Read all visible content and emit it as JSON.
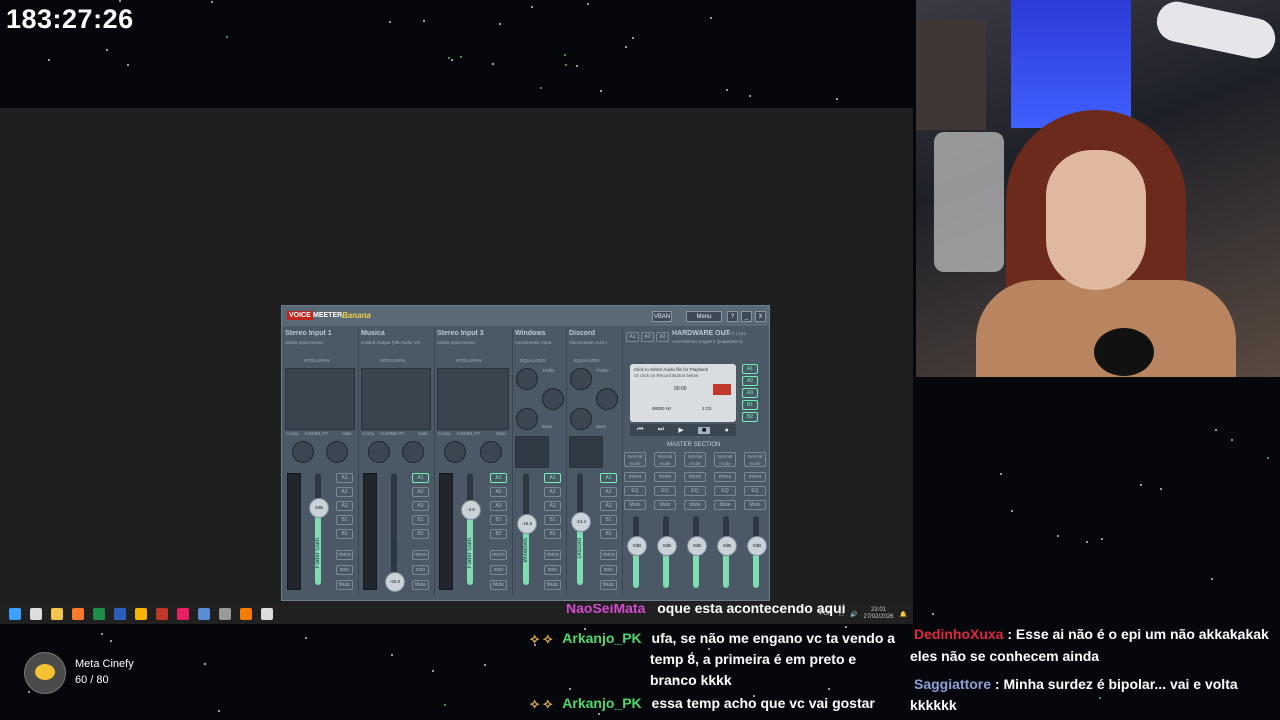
{
  "overlay": {
    "timer": "183:27:26"
  },
  "voicemeeter": {
    "logo_voice": "VOICE",
    "logo_meeter": "MEETER",
    "logo_banana": "Banana",
    "vban_label": "VBAN",
    "menu_label": "Menu",
    "help_label": "?",
    "minimize_label": "_",
    "close_label": "X",
    "strips": [
      {
        "name": "Stereo Input 1",
        "sub": "Select Input Device",
        "gain": "0dB",
        "level": 0.7,
        "label": "Fader Gain"
      },
      {
        "name": "Musica",
        "sub": "CABLE Output (VB-Audio Virt",
        "gain": "-60.0",
        "level": 0.04,
        "label": "Fader Gain"
      },
      {
        "name": "Stereo Input 3",
        "sub": "Select Input Device",
        "gain": "-3.6",
        "level": 0.68,
        "label": "Fader Gain"
      },
      {
        "name": "Windows",
        "sub": "Voicemeeter Input",
        "gain": "-15.6",
        "level": 0.55,
        "label": "Windows"
      },
      {
        "name": "Discord",
        "sub": "Voicemeeter AUX I",
        "gain": "-13.2",
        "level": 0.57,
        "label": "Discord"
      }
    ],
    "intellipan": "INTELLIPAN",
    "audibility": "AUDIBILITY",
    "comp": "Comp.",
    "gate": "Gate",
    "equalizer": "EQUALIZER",
    "treble": "Treble",
    "bass": "Bass",
    "bus_buttons": [
      "A1",
      "A2",
      "A3",
      "B1",
      "B2"
    ],
    "mono": "mono",
    "solo": "solo",
    "mute": "Mute",
    "hardware_out": "HARDWARE OUT",
    "hardware_rate": "48kHz | 512",
    "hardware_device": "A4s-Hiteritos (HyperX QuadCast S)",
    "outputs_a": [
      "A1",
      "A2",
      "A3"
    ],
    "cassette_line1": "Click to Select Audio file for Playback",
    "cassette_line2": "Or click on Record Button below",
    "cassette_time": "00:00",
    "cassette_rate": "48000 Hz",
    "cassette_ch": "2 Ch",
    "master_section": "MASTER SECTION",
    "master_slots": [
      {
        "mode": "Normal mode",
        "gain": "0dB",
        "level": 0.6
      },
      {
        "mode": "Normal mode",
        "gain": "0dB",
        "level": 0.6
      },
      {
        "mode": "Normal mode",
        "gain": "0dB",
        "level": 0.6
      },
      {
        "mode": "Normal mode",
        "gain": "0dB",
        "level": 0.6
      },
      {
        "mode": "Normal mode",
        "gain": "0dB",
        "level": 0.6
      }
    ]
  },
  "taskbar": {
    "icons": [
      "windows-icon",
      "search-icon",
      "file-explorer-icon",
      "firefox-icon",
      "excel-icon",
      "word-icon",
      "chrome-icon",
      "app-icon",
      "media-icon",
      "vpn-icon",
      "app2-icon",
      "vlc-icon",
      "obs-icon"
    ],
    "lang": "POR",
    "time": "23:01",
    "date": "27/02/2026"
  },
  "profile": {
    "name": "Meta Cinefy",
    "count": "60 / 80"
  },
  "chat_left": [
    {
      "user": "NaoSeiMata",
      "text": "oque esta acontecendo aqui",
      "color": "#d24bd0"
    },
    {
      "user": "Arkanjo_PK",
      "text": "ufa, se não me engano vc ta vendo a",
      "cont1": "temp 8, a primeira é em preto e",
      "cont2": "branco kkkk",
      "color": "#4fd86a"
    },
    {
      "user": "Arkanjo_PK",
      "text": "essa temp acho que vc vai gostar",
      "color": "#4fd86a"
    }
  ],
  "chat_right": [
    {
      "user": "DedinhoXuxa",
      "text": "Esse ai não é o epi um não akkakakak",
      "cont": "eles não se conhecem ainda",
      "color": "#e0283c"
    },
    {
      "user": "Saggiattore",
      "text": "Minha surdez é bipolar... vai e volta",
      "cont": "kkkkkk",
      "color": "#8ea0d8"
    }
  ]
}
